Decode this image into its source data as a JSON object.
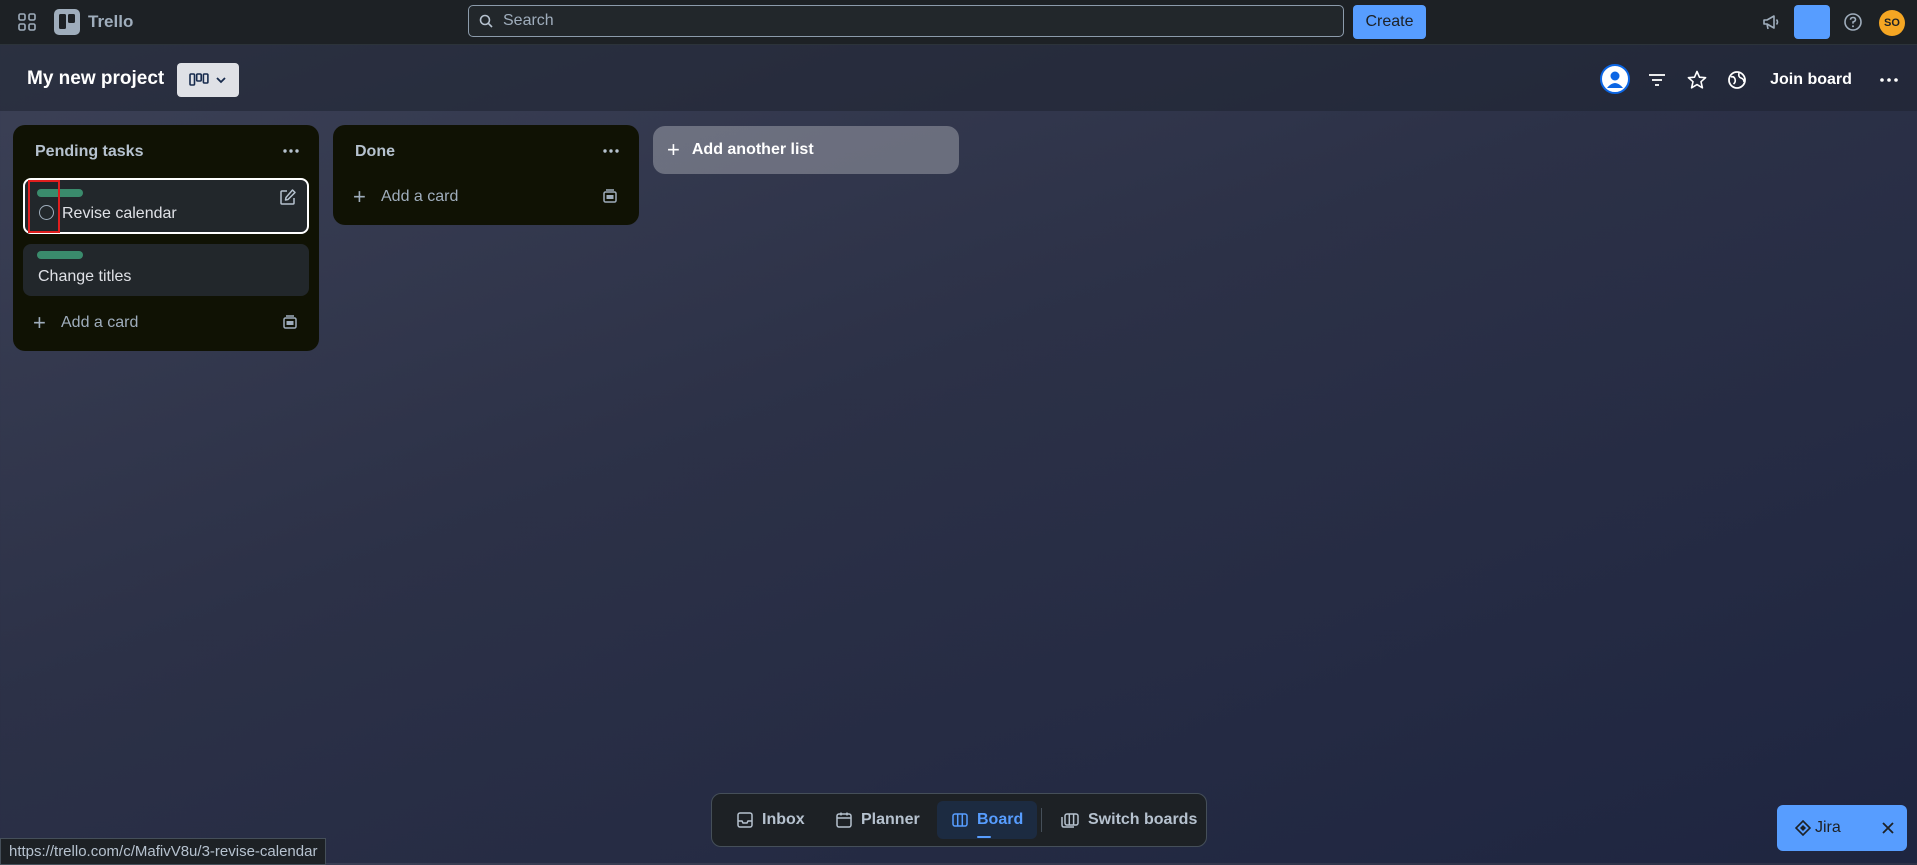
{
  "topnav": {
    "app_name": "Trello",
    "search_placeholder": "Search",
    "create_label": "Create",
    "avatar_initials": "SO"
  },
  "board": {
    "title": "My new project",
    "join_label": "Join board"
  },
  "lists": [
    {
      "title": "Pending tasks",
      "cards": [
        {
          "title": "Revise calendar",
          "label_color": "#4bce97"
        },
        {
          "title": "Change titles",
          "label_color": "#4bce97"
        }
      ],
      "add_card_label": "Add a card"
    },
    {
      "title": "Done",
      "cards": [],
      "add_card_label": "Add a card"
    }
  ],
  "add_list_label": "Add another list",
  "bottom_nav": {
    "inbox": "Inbox",
    "planner": "Planner",
    "board": "Board",
    "switch": "Switch boards"
  },
  "jira": {
    "label": "Jira"
  },
  "status_url": "https://trello.com/c/MafivV8u/3-revise-calendar",
  "colors": {
    "accent": "#579dff",
    "list_bg": "#101204",
    "card_bg": "#22272b",
    "highlight": "#e01e1e"
  }
}
